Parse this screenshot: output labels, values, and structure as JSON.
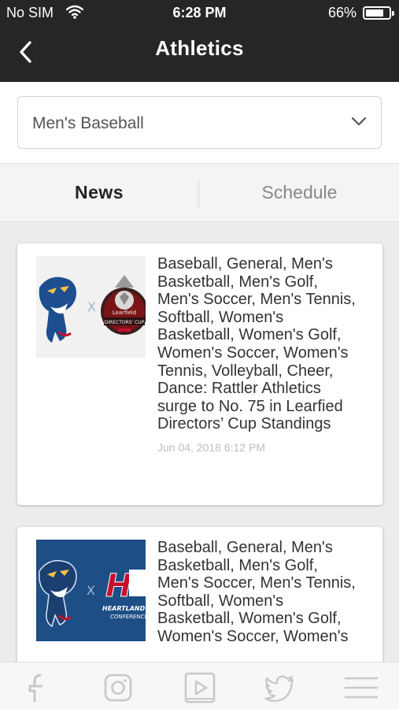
{
  "status_bar": {
    "carrier": "No SIM",
    "time": "6:28 PM",
    "battery": "66%"
  },
  "header": {
    "title": "Athletics"
  },
  "sport_select": {
    "value": "Men's Baseball"
  },
  "tabs": [
    {
      "label": "News",
      "active": true
    },
    {
      "label": "Schedule",
      "active": false
    }
  ],
  "news": [
    {
      "title": "Baseball, General, Men's Basketball, Men's Golf, Men's Soccer, Men's Tennis, Softball, Women's Basketball, Women's Golf, Women's Soccer, Women's Tennis, Volleyball, Cheer, Dance: Rattler Athletics surge to No. 75 in Learfied Directors’ Cup Standings",
      "date": "Jun 04, 2018 6:12 PM",
      "thumb_logo_text": [
        "Learfield",
        "DIRECTORS' CUP"
      ]
    },
    {
      "title": "Baseball, General, Men's Basketball, Men's Golf, Men's Soccer, Men's Tennis, Softball, Women's Basketball, Women's Golf, Women's Soccer, Women's",
      "thumb_logo_text": [
        "H",
        "HEARTLAND",
        "CONFERENCE"
      ]
    }
  ],
  "bottom_bar": {
    "icons": [
      "facebook-icon",
      "instagram-icon",
      "video-icon",
      "twitter-icon",
      "menu-icon"
    ]
  },
  "colors": {
    "header_bg": "#262626",
    "page_bg": "#ececec",
    "thumb2_bg": "#1e4e86",
    "mascot_blue": "#1d4e8f",
    "accent_red": "#c8102e"
  }
}
